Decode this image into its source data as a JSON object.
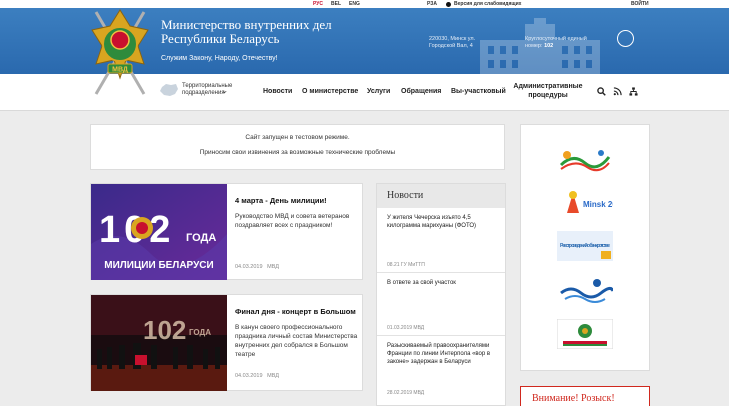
{
  "topbar": {
    "langs": [
      "РУС",
      "BEL",
      "ENG"
    ],
    "rza": "РЗА",
    "low_vision": "Версия для слабовидящих",
    "login": "ВОЙТИ"
  },
  "header": {
    "title_line1": "Министерство внутренних дел",
    "title_line2": "Республики Беларусь",
    "slogan": "Служим Закону, Народу, Отечеству!",
    "address_line1": "220030, Минск ул.",
    "address_line2": "Городской Вал, 4",
    "phone_line1": "Круглосуточный единый",
    "phone_label": "номер:",
    "phone_number": "102",
    "emblem_text": "МВД"
  },
  "nav": {
    "territorial_line1": "Территориальные",
    "territorial_line2": "подразделения",
    "items": [
      "Новости",
      "О министерстве",
      "Услуги",
      "Обращения",
      "Вы-участковый"
    ],
    "admin_line1": "Административные",
    "admin_line2": "процедуры",
    "icons": [
      "search-icon",
      "rss-icon",
      "sitemap-icon"
    ]
  },
  "notice": {
    "line1": "Сайт запущен в тестовом режиме.",
    "line2": "Приносим свои извинения за возможные технические проблемы"
  },
  "news": [
    {
      "title": "4 марта - День милиции!",
      "desc": "Руководство МВД и совета ветеранов поздравляет всех с праздником!",
      "date": "04.03.2019",
      "source": "МВД",
      "img_number": "102",
      "img_word": "ГОДА",
      "img_caption": "МИЛИЦИИ БЕЛАРУСИ"
    },
    {
      "title": "Финал дня - концерт в Большом",
      "desc": "В канун своего профессионального праздника личный состав Министерства внутренних дел собрался в Большом театре",
      "date": "04.03.2019",
      "source": "МВД",
      "img_number": "102",
      "img_word": "ГОДА"
    }
  ],
  "news_list": {
    "header": "Новости",
    "items": [
      {
        "title": "У жителя Чечерска изъято 4,5 килограмма марихуаны (ФОТО)",
        "date": "08.21 ГУ МиТТП"
      },
      {
        "title": "В ответе за свой участок",
        "date": "01.03.2019 МВД"
      },
      {
        "title": "Разыскиваемый правоохранителями Франции по линии Интерпола «вор в законе» задержан в Беларуси",
        "date": "28.02.2019 МВД"
      }
    ]
  },
  "banners": {
    "items": [
      "Европейские игры 2019",
      "Минск 2019",
      "Реестр сведений о банкротстве",
      "banner-4",
      "banner-5"
    ],
    "minsk_label": "Minsk 2019",
    "registry_label": "Реестр сведений о банкротстве"
  },
  "wanted": {
    "label": "Внимание! Розыск!"
  },
  "colors": {
    "header_blue": "#2a69ae",
    "accent_red": "#c8102e",
    "wanted_red": "#d0281e"
  }
}
